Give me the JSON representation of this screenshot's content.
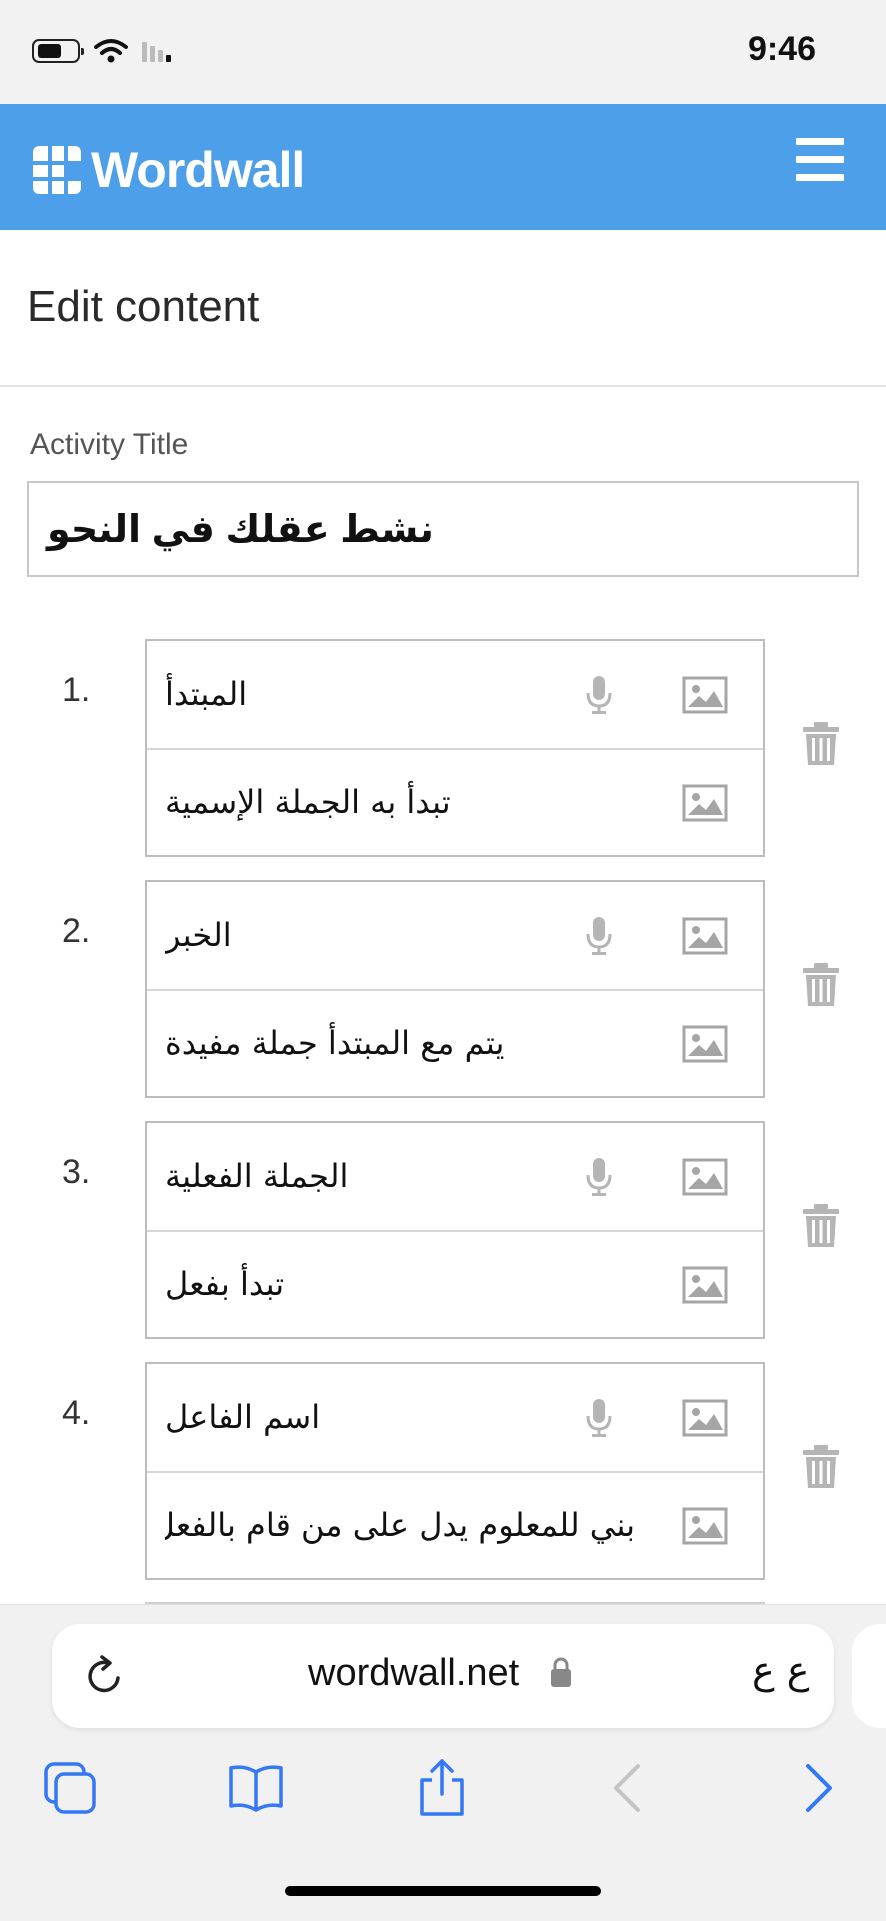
{
  "status": {
    "time": "9:46"
  },
  "header": {
    "logo_text": "Wordwall"
  },
  "page": {
    "title": "Edit content"
  },
  "activity": {
    "label": "Activity Title",
    "title_value": "نشط عقلك في النحو"
  },
  "items": [
    {
      "number": "1.",
      "term": "المبتدأ",
      "definition": "تبدأ به الجملة الإسمية"
    },
    {
      "number": "2.",
      "term": "الخبر",
      "definition": "يتم مع المبتدأ جملة مفيدة"
    },
    {
      "number": "3.",
      "term": "الجملة الفعلية",
      "definition": "تبدأ بفعل"
    },
    {
      "number": "4.",
      "term": "اسم الفاعل",
      "definition": "بني للمعلوم يدل على من قام بالفعل"
    }
  ],
  "browser": {
    "url": "wordwall.net",
    "text_size": "ع ع"
  },
  "colors": {
    "header_bg": "#4d9fe9",
    "accent": "#3478f6"
  }
}
